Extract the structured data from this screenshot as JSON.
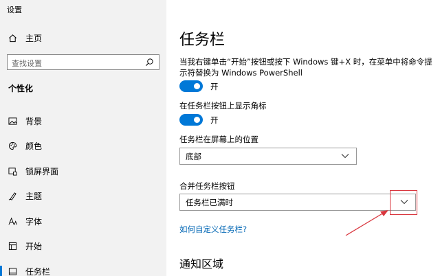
{
  "window": {
    "title": "设置"
  },
  "sidebar": {
    "home_label": "主页",
    "search_placeholder": "查找设置",
    "section_title": "个性化",
    "items": [
      {
        "label": "背景",
        "icon": "picture-icon"
      },
      {
        "label": "颜色",
        "icon": "palette-icon"
      },
      {
        "label": "锁屏界面",
        "icon": "lock-screen-icon"
      },
      {
        "label": "主题",
        "icon": "theme-icon"
      },
      {
        "label": "字体",
        "icon": "font-icon"
      },
      {
        "label": "开始",
        "icon": "start-icon"
      },
      {
        "label": "任务栏",
        "icon": "taskbar-icon",
        "active": true
      }
    ]
  },
  "main": {
    "title": "任务栏",
    "setting1_desc": "当我右键单击“开始”按钮或按下 Windows 键+X 时，在菜单中将命令提示符替换为 Windows PowerShell",
    "setting1_state": "开",
    "setting2_desc": "在任务栏按钮上显示角标",
    "setting2_state": "开",
    "position_label": "任务栏在屏幕上的位置",
    "position_value": "底部",
    "combine_label": "合并任务栏按钮",
    "combine_value": "任务栏已满时",
    "customize_link": "如何自定义任务栏?",
    "notification_section": "通知区域"
  },
  "colors": {
    "accent": "#0078d7",
    "annotation": "#d9363e"
  }
}
